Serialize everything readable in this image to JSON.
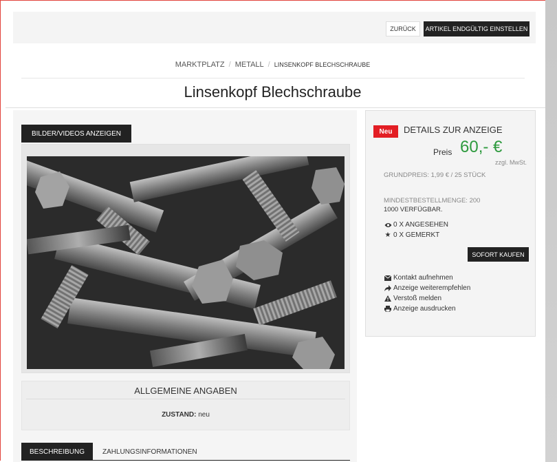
{
  "topbar": {
    "back_label": "ZURÜCK",
    "publish_label": "ARTIKEL ENDGÜLTIG EINSTELLEN"
  },
  "breadcrumb": {
    "items": [
      "MARKTPLATZ",
      "METALL"
    ],
    "current": "LINSENKOPF BLECHSCHRAUBE"
  },
  "page_title": "Linsenkopf Blechschraube",
  "media": {
    "button_label": "BILDER/VIDEOS ANZEIGEN",
    "image_subject": "bolts-photo"
  },
  "general": {
    "heading": "ALLGEMEINE ANGABEN",
    "condition_label": "ZUSTAND:",
    "condition_value": "neu"
  },
  "tabs": {
    "description": "BESCHREIBUNG",
    "payment": "ZAHLUNGSINFORMATIONEN"
  },
  "details": {
    "badge": "Neu",
    "title": "DETAILS ZUR ANZEIGE",
    "price_label": "Preis",
    "price": "60,- €",
    "tax_note": "zzgl. MwSt.",
    "base_price": "GRUNDPREIS: 1,99 € / 25 STÜCK",
    "min_order": "MINDESTBESTELLMENGE: 200",
    "available": "1000 VERFÜGBAR.",
    "views": "0 X ANGESEHEN",
    "saved": "0 X GEMERKT",
    "buy_label": "SOFORT KAUFEN",
    "actions": {
      "contact": "Kontakt aufnehmen",
      "recommend": "Anzeige weiterempfehlen",
      "report": "Verstoß melden",
      "print": "Anzeige ausdrucken"
    }
  },
  "colors": {
    "accent_dark": "#222222",
    "badge_red": "#e31e24",
    "price_green": "#2e9a3e"
  }
}
